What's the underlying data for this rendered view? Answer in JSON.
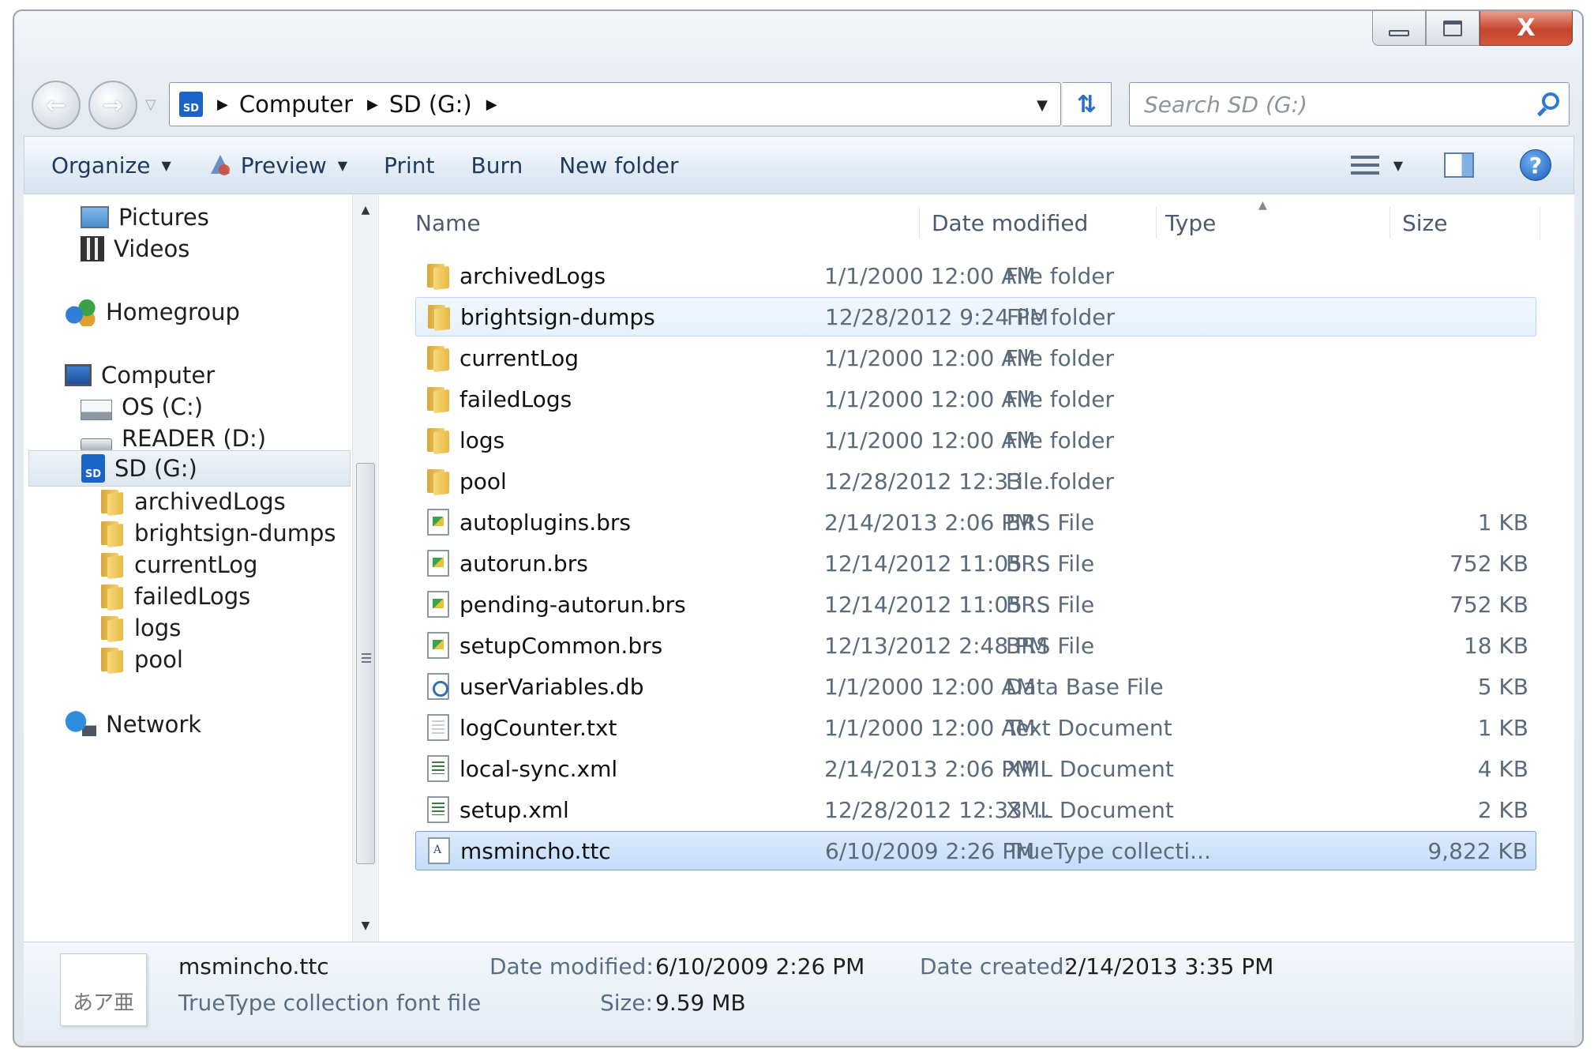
{
  "window": {
    "caption": {
      "minimize_icon": "minimize-icon",
      "maximize_icon": "maximize-icon",
      "close_glyph": "X"
    }
  },
  "nav": {
    "back_icon": "back-arrow-icon",
    "forward_icon": "forward-arrow-icon",
    "address": {
      "drive_badge": "SD",
      "crumbs": [
        "Computer",
        "SD (G:)"
      ]
    },
    "search_placeholder": "Search SD (G:)"
  },
  "toolbar": {
    "organize": "Organize",
    "preview": "Preview",
    "print": "Print",
    "burn": "Burn",
    "new_folder": "New folder",
    "help_glyph": "?"
  },
  "navpane": {
    "items": [
      {
        "label": "Pictures",
        "icon": "pictures-icon"
      },
      {
        "label": "Videos",
        "icon": "videos-icon"
      },
      {
        "label": "Homegroup",
        "icon": "homegroup-icon"
      },
      {
        "label": "Computer",
        "icon": "computer-icon"
      },
      {
        "label": "OS (C:)",
        "icon": "os-drive-icon"
      },
      {
        "label": "READER (D:)",
        "icon": "reader-drive-icon"
      },
      {
        "label": "SD (G:)",
        "icon": "sd-drive-icon",
        "selected": true
      },
      {
        "label": "archivedLogs",
        "icon": "folder-icon"
      },
      {
        "label": "brightsign-dumps",
        "icon": "folder-icon"
      },
      {
        "label": "currentLog",
        "icon": "folder-icon"
      },
      {
        "label": "failedLogs",
        "icon": "folder-icon"
      },
      {
        "label": "logs",
        "icon": "folder-icon"
      },
      {
        "label": "pool",
        "icon": "folder-icon"
      },
      {
        "label": "Network",
        "icon": "network-icon"
      }
    ]
  },
  "list": {
    "columns": {
      "name": "Name",
      "date": "Date modified",
      "type": "Type",
      "size": "Size"
    },
    "sorted_by": "Type",
    "rows": [
      {
        "name": "archivedLogs",
        "date": "1/1/2000 12:00 AM",
        "type": "File folder",
        "size": "",
        "icon": "folder"
      },
      {
        "name": "brightsign-dumps",
        "date": "12/28/2012 9:24 PM",
        "type": "File folder",
        "size": "",
        "icon": "folder",
        "state": "hover"
      },
      {
        "name": "currentLog",
        "date": "1/1/2000 12:00 AM",
        "type": "File folder",
        "size": "",
        "icon": "folder"
      },
      {
        "name": "failedLogs",
        "date": "1/1/2000 12:00 AM",
        "type": "File folder",
        "size": "",
        "icon": "folder"
      },
      {
        "name": "logs",
        "date": "1/1/2000 12:00 AM",
        "type": "File folder",
        "size": "",
        "icon": "folder"
      },
      {
        "name": "pool",
        "date": "12/28/2012 12:33 ...",
        "type": "File folder",
        "size": "",
        "icon": "folder"
      },
      {
        "name": "autoplugins.brs",
        "date": "2/14/2013 2:06 PM",
        "type": "BRS File",
        "size": "1 KB",
        "icon": "brs"
      },
      {
        "name": "autorun.brs",
        "date": "12/14/2012 11:05 ...",
        "type": "BRS File",
        "size": "752 KB",
        "icon": "brs"
      },
      {
        "name": "pending-autorun.brs",
        "date": "12/14/2012 11:05 ...",
        "type": "BRS File",
        "size": "752 KB",
        "icon": "brs"
      },
      {
        "name": "setupCommon.brs",
        "date": "12/13/2012 2:48 PM",
        "type": "BRS File",
        "size": "18 KB",
        "icon": "brs"
      },
      {
        "name": "userVariables.db",
        "date": "1/1/2000 12:00 AM",
        "type": "Data Base File",
        "size": "5 KB",
        "icon": "db"
      },
      {
        "name": "logCounter.txt",
        "date": "1/1/2000 12:00 AM",
        "type": "Text Document",
        "size": "1 KB",
        "icon": "txt"
      },
      {
        "name": "local-sync.xml",
        "date": "2/14/2013 2:06 PM",
        "type": "XML Document",
        "size": "4 KB",
        "icon": "xml"
      },
      {
        "name": "setup.xml",
        "date": "12/28/2012 12:33 ...",
        "type": "XML Document",
        "size": "2 KB",
        "icon": "xml"
      },
      {
        "name": "msmincho.ttc",
        "date": "6/10/2009 2:26 PM",
        "type": "TrueType collecti...",
        "size": "9,822 KB",
        "icon": "font",
        "state": "selected"
      }
    ]
  },
  "details": {
    "thumb_text": "あア亜",
    "filename": "msmincho.ttc",
    "filetype": "TrueType collection font file",
    "date_modified_label": "Date modified:",
    "date_modified": "6/10/2009 2:26 PM",
    "size_label": "Size:",
    "size": "9.59 MB",
    "date_created_label": "Date created:",
    "date_created": "2/14/2013 3:35 PM"
  },
  "colors": {
    "selection_border": "#7da2ce",
    "selection_fill": "#c4ddfa",
    "toolbar_text": "#1e3a5c",
    "secondary_text": "#5b6b7b"
  }
}
